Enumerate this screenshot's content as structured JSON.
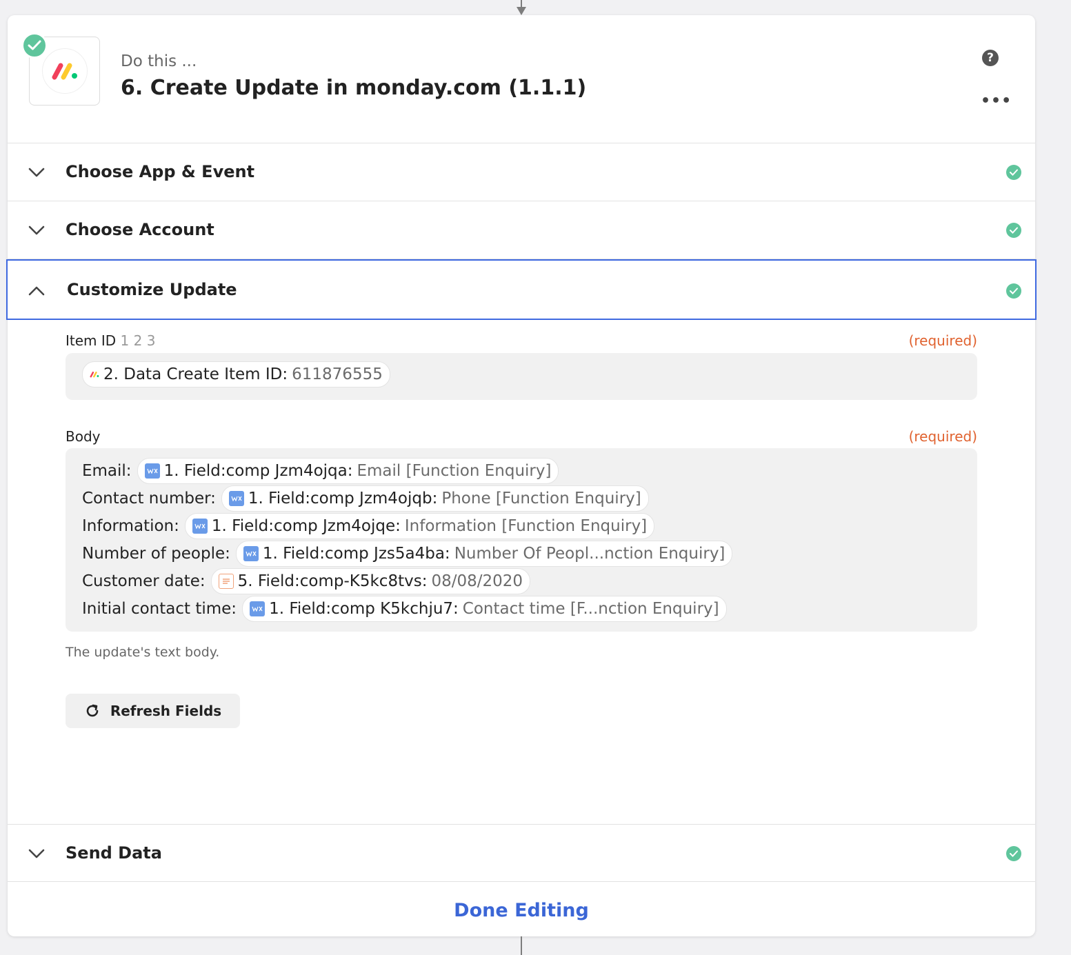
{
  "step": {
    "prefix": "Do this ...",
    "title": "6. Create Update in monday.com (1.1.1)",
    "help_symbol": "?",
    "more_symbol": "•••"
  },
  "sections": {
    "choose_app": "Choose App & Event",
    "choose_account": "Choose Account",
    "customize": "Customize Update",
    "send_data": "Send Data"
  },
  "item_id": {
    "label": "Item ID",
    "nums": "1 2 3",
    "required": "(required)",
    "pill_label": "2. Data Create Item ID:",
    "pill_value": "611876555"
  },
  "body_field": {
    "label": "Body",
    "required": "(required)",
    "lines": [
      {
        "label": "Email:",
        "pill_label": "1. Field:comp Jzm4ojqa:",
        "pill_value": "Email [Function Enquiry]",
        "icon": "wix-icon"
      },
      {
        "label": "Contact number:",
        "pill_label": "1. Field:comp Jzm4ojqb:",
        "pill_value": "Phone [Function Enquiry]",
        "icon": "wix-icon"
      },
      {
        "label": "Information:",
        "pill_label": "1. Field:comp Jzm4ojqe:",
        "pill_value": "Information [Function Enquiry]",
        "icon": "wix-icon"
      },
      {
        "label": "Number of people:",
        "pill_label": "1. Field:comp Jzs5a4ba:",
        "pill_value": "Number Of Peopl...nction Enquiry]",
        "icon": "wix-icon"
      },
      {
        "label": "Customer date:",
        "pill_label": "5. Field:comp-K5kc8tvs:",
        "pill_value": "08/08/2020",
        "icon": "form-icon"
      },
      {
        "label": "Initial contact time:",
        "pill_label": "1. Field:comp K5kchju7:",
        "pill_value": "Contact time [F...nction Enquiry]",
        "icon": "wix-icon"
      }
    ],
    "helper": "The update's text body."
  },
  "buttons": {
    "refresh": "Refresh Fields",
    "done": "Done Editing"
  },
  "colors": {
    "accent": "#3f69e0",
    "success": "#5fc59c",
    "required": "#e0622f"
  }
}
